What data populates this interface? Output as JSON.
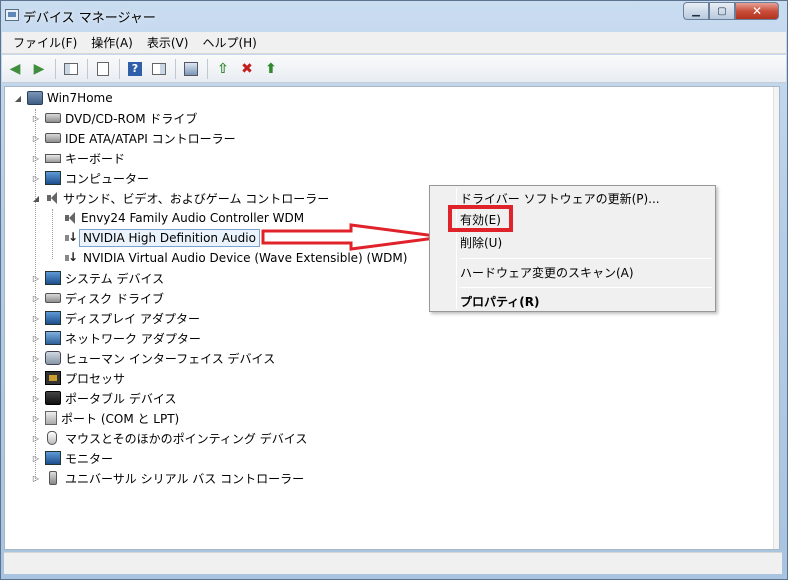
{
  "window": {
    "title": "デバイス マネージャー"
  },
  "menu": [
    "ファイル(F)",
    "操作(A)",
    "表示(V)",
    "ヘルプ(H)"
  ],
  "toolbar": {
    "buttons": [
      {
        "icon": "back-arrow-icon"
      },
      {
        "icon": "forward-arrow-icon"
      },
      {
        "icon": "show-hide-console-tree-icon"
      },
      {
        "icon": "properties-icon"
      },
      {
        "icon": "help-icon"
      },
      {
        "icon": "action-pane-icon"
      },
      {
        "icon": "scan-hardware-icon"
      },
      {
        "icon": "update-driver-icon"
      },
      {
        "icon": "uninstall-icon"
      },
      {
        "icon": "enable-device-icon"
      }
    ]
  },
  "tree": {
    "root": "Win7Home",
    "items": [
      "DVD/CD-ROM ドライブ",
      "IDE ATA/ATAPI コントローラー",
      "キーボード",
      "コンピューター",
      "サウンド、ビデオ、およびゲーム コントローラー",
      "Envy24 Family Audio Controller WDM",
      "NVIDIA High Definition Audio",
      "NVIDIA Virtual Audio Device (Wave Extensible) (WDM)",
      "システム デバイス",
      "ディスク ドライブ",
      "ディスプレイ アダプター",
      "ネットワーク アダプター",
      "ヒューマン インターフェイス デバイス",
      "プロセッサ",
      "ポータブル デバイス",
      "ポート (COM と LPT)",
      "マウスとそのほかのポインティング デバイス",
      "モニター",
      "ユニバーサル シリアル バス コントローラー"
    ]
  },
  "context_menu": {
    "update_driver": "ドライバー ソフトウェアの更新(P)...",
    "enable": "有効(E)",
    "uninstall": "削除(U)",
    "scan": "ハードウェア変更のスキャン(A)",
    "properties": "プロパティ(R)"
  },
  "colors": {
    "highlight": "#e0232a",
    "selection_border": "#7da2ce"
  }
}
